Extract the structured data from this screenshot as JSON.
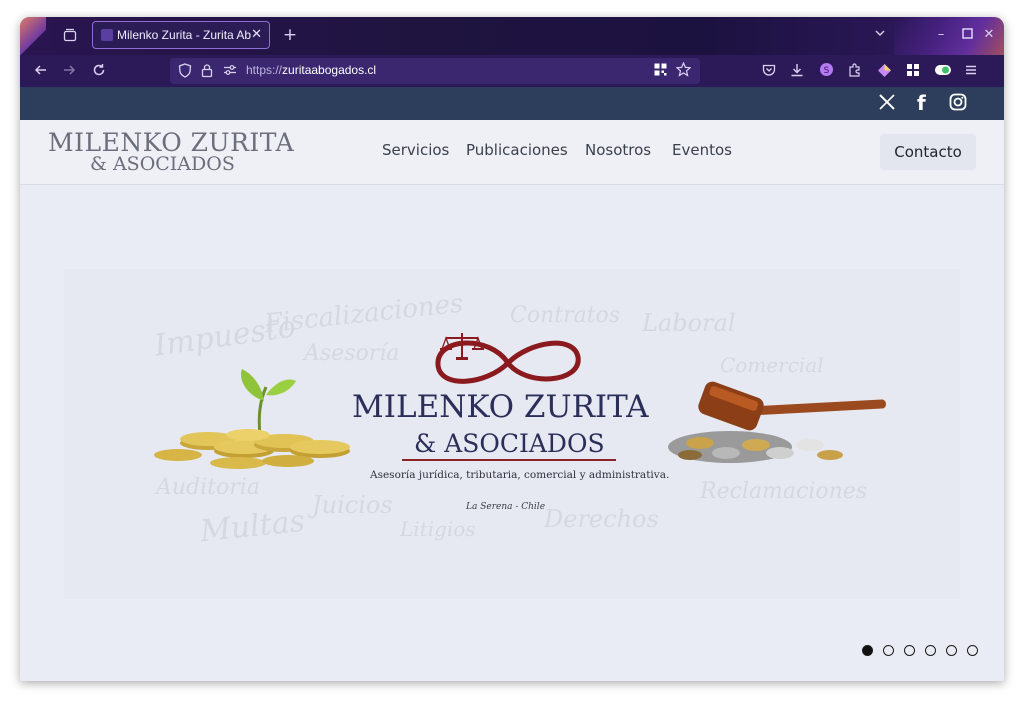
{
  "browser": {
    "tab_title": "Milenko Zurita - Zurita Ab",
    "url_scheme": "https://",
    "url_host": "zuritaabogados.cl",
    "accent": "#8d6fd6"
  },
  "social": {
    "x_label": "𝕏",
    "facebook_label": "f",
    "instagram_label": "◎"
  },
  "header": {
    "logo_line1": "MILENKO ZURITA",
    "logo_line2": "& ASOCIADOS",
    "menu": [
      {
        "label": "Servicios"
      },
      {
        "label": "Publicaciones"
      },
      {
        "label": "Nosotros"
      },
      {
        "label": "Eventos"
      }
    ],
    "contact_label": "Contacto"
  },
  "banner": {
    "title_line1": "MILENKO ZURITA",
    "title_line2": "& ASOCIADOS",
    "subtitle": "Asesoría jurídica, tributaria, comercial y administrativa.",
    "location": "La Serena - Chile",
    "background_words": [
      "Impuesto",
      "Fiscalizaciones",
      "Asesoría",
      "Contratos",
      "Laboral",
      "Comercial",
      "Auditoria",
      "Juicios",
      "Litigios",
      "Multas",
      "Derechos",
      "Reclamaciones"
    ]
  },
  "carousel": {
    "slide_count": 6,
    "active_index": 0
  }
}
